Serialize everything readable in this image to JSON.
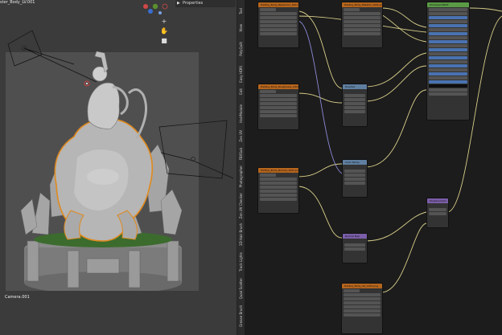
{
  "viewport": {
    "title": "ster_Body_LV.001",
    "camera_name": "Camera.001",
    "tool_icons": [
      "cursor-icon",
      "hand-icon",
      "camera-view-icon"
    ]
  },
  "properties_header": {
    "label": "Properties"
  },
  "n_panel": {
    "tabs": [
      "Tool",
      "View",
      "PolyQuilt",
      "Easy HDRI",
      "Edit",
      "HairModule",
      "Zen UV",
      "FBXSub",
      "Photographer",
      "Zen UV Checker",
      "3D Hair Brush",
      "Track Lights",
      "Quad Scatter",
      "Grease Brush"
    ]
  },
  "node_editor": {
    "nodes": [
      {
        "id": "tex1",
        "title": "Hellboy_Body_BaseColor_1001.png"
      },
      {
        "id": "tex2",
        "title": "Hellboy_Body_Roughness_1001.png"
      },
      {
        "id": "tex3",
        "title": "Hellboy_Body_Normal_1001.png"
      },
      {
        "id": "tex4",
        "title": "Hellboy_Body_Metallic_1001.png"
      },
      {
        "id": "tex5",
        "title": "Hellboy_Body_AO_1001.png"
      },
      {
        "id": "mid1",
        "title": "Hue/Sat"
      },
      {
        "id": "mid2",
        "title": "Color Ramp"
      },
      {
        "id": "mid3",
        "title": "Normal Map"
      },
      {
        "id": "bsdf",
        "title": "Principled BSDF"
      },
      {
        "id": "disp",
        "title": "Displacement"
      }
    ]
  }
}
